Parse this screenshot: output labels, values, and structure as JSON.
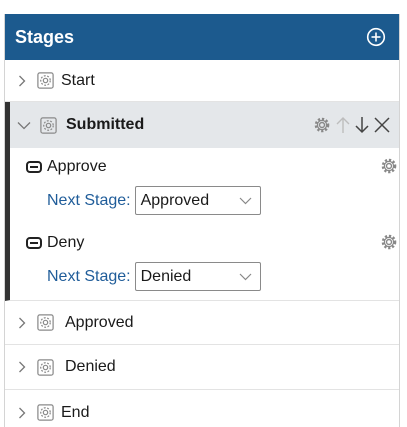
{
  "header": {
    "title": "Stages",
    "add_icon": "plus-circle-icon"
  },
  "stages": [
    {
      "label": "Start",
      "expanded": false
    },
    {
      "label": "Submitted",
      "expanded": true
    },
    {
      "label": "Approved",
      "expanded": false
    },
    {
      "label": "Denied",
      "expanded": false
    },
    {
      "label": "End",
      "expanded": false
    }
  ],
  "submitted": {
    "title": "Submitted",
    "actions": [
      {
        "name": "Approve",
        "next_stage_label": "Next Stage:",
        "next_stage_value": "Approved"
      },
      {
        "name": "Deny",
        "next_stage_label": "Next Stage:",
        "next_stage_value": "Denied"
      }
    ]
  },
  "colors": {
    "header_bg": "#1c5a8e",
    "expanded_bg": "#e4e7ea",
    "accent_bar": "#333333",
    "link_text": "#1f5c99"
  }
}
